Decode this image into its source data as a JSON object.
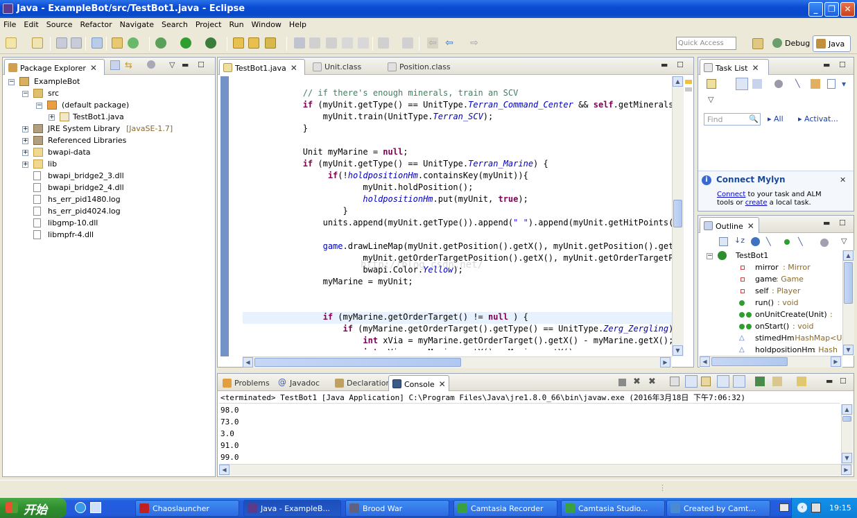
{
  "window": {
    "title": "Java - ExampleBot/src/TestBot1.java - Eclipse"
  },
  "menu": [
    "File",
    "Edit",
    "Source",
    "Refactor",
    "Navigate",
    "Search",
    "Project",
    "Run",
    "Window",
    "Help"
  ],
  "toolbar": {
    "quick_access_placeholder": "Quick Access",
    "perspective_debug": "Debug",
    "perspective_java": "Java"
  },
  "package_explorer": {
    "tab_label": "Package Explorer",
    "tree": [
      {
        "label": "ExampleBot"
      },
      {
        "label": "src"
      },
      {
        "label": "(default package)"
      },
      {
        "label": "TestBot1.java"
      },
      {
        "label": "JRE System Library",
        "suffix": "[JavaSE-1.7]"
      },
      {
        "label": "Referenced Libraries"
      },
      {
        "label": "bwapi-data"
      },
      {
        "label": "lib"
      },
      {
        "label": "bwapi_bridge2_3.dll"
      },
      {
        "label": "bwapi_bridge2_4.dll"
      },
      {
        "label": "hs_err_pid1480.log"
      },
      {
        "label": "hs_err_pid4024.log"
      },
      {
        "label": "libgmp-10.dll"
      },
      {
        "label": "libmpfr-4.dll"
      }
    ]
  },
  "editor": {
    "tabs": [
      {
        "label": "TestBot1.java",
        "active": true
      },
      {
        "label": "Unit.class",
        "active": false
      },
      {
        "label": "Position.class",
        "active": false
      }
    ],
    "watermark": "http://blog.csdn.net/"
  },
  "task_list": {
    "tab_label": "Task List",
    "find_placeholder": "Find",
    "all_label": "All",
    "activate_label": "Activat...",
    "mylyn_title": "Connect Mylyn",
    "mylyn_connect": "Connect",
    "mylyn_text1": " to your task and ALM",
    "mylyn_text2": "tools or ",
    "mylyn_create": "create",
    "mylyn_text3": " a local task."
  },
  "outline": {
    "tab_label": "Outline",
    "class_name": "TestBot1",
    "members": [
      {
        "name": "mirror",
        "type": " : Mirror",
        "icon": "private-field"
      },
      {
        "name": "game",
        "type": " : Game",
        "icon": "private-field"
      },
      {
        "name": "self",
        "type": " : Player",
        "icon": "private-field"
      },
      {
        "name": "run()",
        "type": " : void",
        "icon": "public-method"
      },
      {
        "name": "onUnitCreate(Unit)",
        "type": " : ",
        "icon": "public-method"
      },
      {
        "name": "onStart()",
        "type": " : void",
        "icon": "public-method"
      },
      {
        "name": "stimedHm",
        "type": " : HashMap<Un",
        "icon": "static-field"
      },
      {
        "name": "holdpositionHm",
        "type": " : Hash",
        "icon": "static-field"
      }
    ]
  },
  "console": {
    "tabs": [
      "Problems",
      "Javadoc",
      "Declaration",
      "Console"
    ],
    "status": "<terminated> TestBot1 [Java Application] C:\\Program Files\\Java\\jre1.8.0_66\\bin\\javaw.exe (2016年3月18日 下午7:06:32)",
    "output": [
      "98.0",
      "73.0",
      "3.0",
      "91.0",
      "99.0"
    ]
  },
  "taskbar": {
    "start_label": "开始",
    "tasks": [
      "Chaoslauncher",
      "Java - ExampleB...",
      "Brood War",
      "Camtasia Recorder",
      "Camtasia Studio...",
      "Created by Camt..."
    ],
    "clock": "19:15"
  },
  "colors": {
    "keyword": "#7f0055",
    "comment": "#3f7f5f",
    "field": "#0000c0",
    "string": "#2a00ff",
    "titlebar": "#0a4bd3"
  }
}
